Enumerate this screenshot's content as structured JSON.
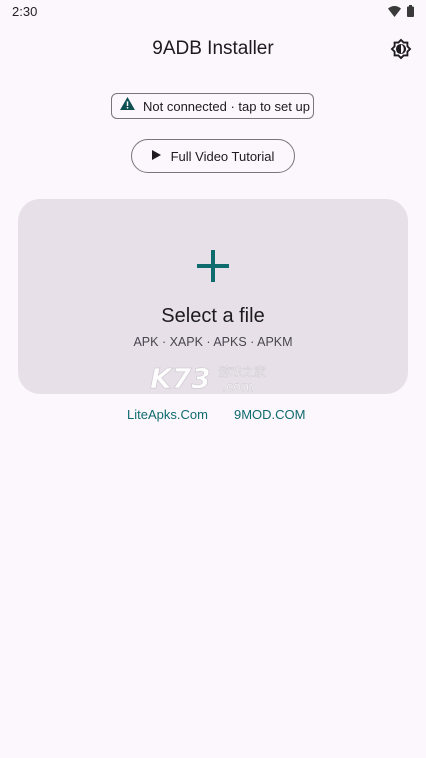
{
  "status_bar": {
    "time": "2:30",
    "icons": [
      "wifi-icon",
      "battery-icon"
    ]
  },
  "app_bar": {
    "title": "9ADB Installer",
    "theme_icon": "brightness-icon"
  },
  "connection_chip": {
    "icon": "warning-icon",
    "label": "Not connected · tap to set up"
  },
  "tutorial_button": {
    "icon": "play-icon",
    "label": "Full Video Tutorial"
  },
  "file_card": {
    "icon": "plus-icon",
    "title": "Select a file",
    "subtitle": "APK · XAPK · APKS · APKM",
    "watermark_main": "K73",
    "watermark_cn": "游戏之家",
    "watermark_com": ".com"
  },
  "links": {
    "liteapks": "LiteApks.Com",
    "ninemod": "9MOD.COM"
  },
  "colors": {
    "background": "#fcf6fd",
    "card": "#e7e0e8",
    "accent": "#0e6b6e",
    "outline": "#79747e"
  }
}
